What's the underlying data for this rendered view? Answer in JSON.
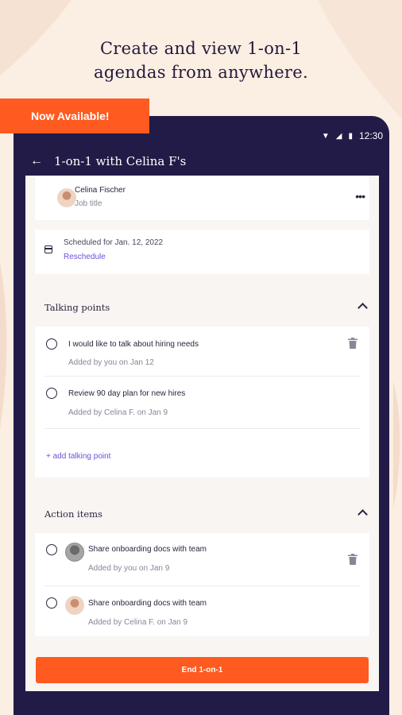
{
  "headline": {
    "line1": "Create and view 1-on-1",
    "line2": "agendas from anywhere."
  },
  "banner": {
    "label": "Now Available!"
  },
  "status_bar": {
    "time": "12:30",
    "icons": [
      "wifi-icon",
      "signal-icon",
      "battery-icon"
    ]
  },
  "app_bar": {
    "title": "1-on-1 with Celina F's",
    "back_icon": "back-arrow-icon"
  },
  "profile": {
    "name": "Celina Fischer",
    "job_title": "Job title",
    "more_icon": "more-icon"
  },
  "schedule": {
    "label": "Scheduled for Jan. 12, 2022",
    "reschedule": "Reschedule"
  },
  "talking_points": {
    "title": "Talking points",
    "items": [
      {
        "text": "I would like to talk about hiring needs",
        "meta": "Added by you on Jan 12"
      },
      {
        "text": "Review 90 day plan for new hires",
        "meta": "Added by Celina F. on Jan 9"
      }
    ],
    "add_label": "+ add talking point"
  },
  "action_items": {
    "title": "Action items",
    "items": [
      {
        "text": "Share onboarding docs with team",
        "meta": "Added by you on Jan 9"
      },
      {
        "text": "Share onboarding docs with team",
        "meta": "Added by Celina F. on Jan 9"
      }
    ]
  },
  "cta": {
    "label": "End 1-on-1"
  },
  "colors": {
    "accent": "#ff5a1f",
    "device_frame": "#231b47",
    "link": "#6f4fd8",
    "page_bg": "#fbeee3"
  }
}
